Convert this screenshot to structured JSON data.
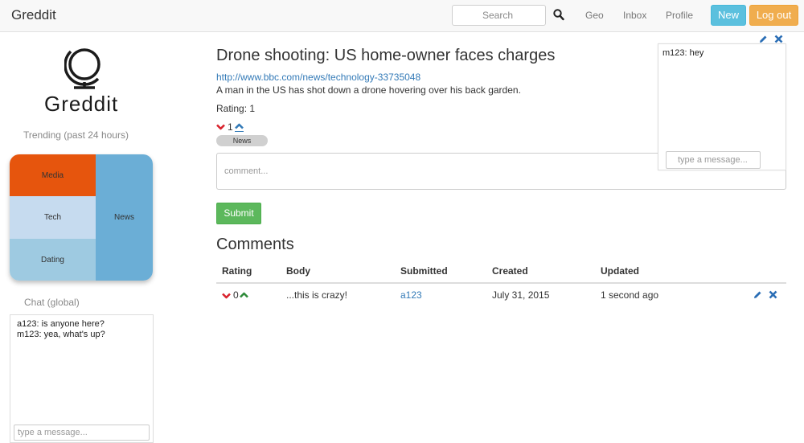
{
  "navbar": {
    "brand": "Greddit",
    "search_placeholder": "Search",
    "links": [
      "Geo",
      "Inbox",
      "Profile"
    ],
    "new_label": "New",
    "logout_label": "Log out"
  },
  "sidebar": {
    "logo_text": "Greddit",
    "trending_heading": "Trending (past 24 hours)",
    "trending_tiles": [
      {
        "label": "Media",
        "color": "#e6550d"
      },
      {
        "label": "Tech",
        "color": "#c6dbef"
      },
      {
        "label": "Dating",
        "color": "#9ecae1"
      },
      {
        "label": "News",
        "color": "#6baed6"
      }
    ],
    "chat_heading": "Chat (global)",
    "chat_messages": [
      "a123: is anyone here?",
      "m123: yea, what's up?"
    ],
    "chat_placeholder": "type a message..."
  },
  "post": {
    "title": "Drone shooting: US home-owner faces charges",
    "link": "http://www.bbc.com/news/technology-33735048",
    "description": "A man in the US has shot down a drone hovering over his back garden.",
    "rating_text": "Rating: 1",
    "vote_count": "1",
    "tag": "News",
    "comment_placeholder": "comment...",
    "submit_label": "Submit"
  },
  "comments": {
    "heading": "Comments",
    "columns": [
      "Rating",
      "Body",
      "Submitted",
      "Created",
      "Updated"
    ],
    "rows": [
      {
        "rating": "0",
        "body": "...this is crazy!",
        "submitted": "a123",
        "created": "July 31, 2015",
        "updated": "1 second ago"
      }
    ]
  },
  "private_chat": {
    "messages": [
      "m123: hey"
    ],
    "placeholder": "type a message..."
  },
  "colors": {
    "link": "#337ab7",
    "new_button": "#5bc0de",
    "logout_button": "#f0ad4e",
    "submit_button": "#5cb85c",
    "vote_down": "#d9232d",
    "vote_up_active": "#337ab7",
    "vote_up": "#2e8b3a",
    "action_icon": "#2a6eb5"
  }
}
